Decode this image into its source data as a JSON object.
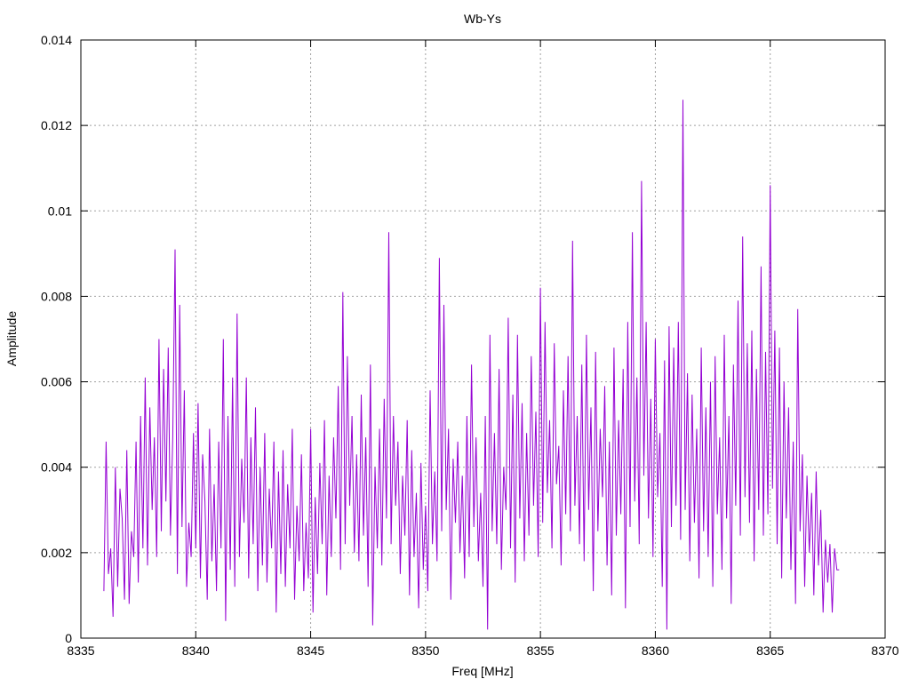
{
  "chart_data": {
    "type": "line",
    "title": "Wb-Ys",
    "xlabel": "Freq [MHz]",
    "ylabel": "Amplitude",
    "xlim": [
      8335,
      8370
    ],
    "ylim": [
      0,
      0.014
    ],
    "xticks": [
      "8335",
      "8340",
      "8345",
      "8350",
      "8355",
      "8360",
      "8365",
      "8370"
    ],
    "yticks": [
      "0",
      "0.002",
      "0.004",
      "0.006",
      "0.008",
      "0.01",
      "0.012",
      "0.014"
    ],
    "grid": true,
    "series": [
      {
        "name": "Wb-Ys",
        "color": "#9400d3",
        "x_start": 8336.0,
        "x_step": 0.1,
        "values": [
          0.0011,
          0.0046,
          0.0015,
          0.0021,
          0.0005,
          0.004,
          0.0012,
          0.0035,
          0.0028,
          0.0009,
          0.0044,
          0.0008,
          0.0025,
          0.0019,
          0.0046,
          0.0013,
          0.0052,
          0.0021,
          0.0061,
          0.0017,
          0.0054,
          0.003,
          0.0047,
          0.0019,
          0.007,
          0.0025,
          0.0063,
          0.0032,
          0.0068,
          0.0024,
          0.0047,
          0.0091,
          0.0015,
          0.0078,
          0.0026,
          0.0058,
          0.0012,
          0.0027,
          0.0019,
          0.0048,
          0.0021,
          0.0055,
          0.0014,
          0.0043,
          0.0032,
          0.0009,
          0.0049,
          0.0018,
          0.0036,
          0.0011,
          0.0046,
          0.0021,
          0.007,
          0.0004,
          0.0052,
          0.0016,
          0.0061,
          0.0012,
          0.0076,
          0.0019,
          0.0042,
          0.0027,
          0.0061,
          0.0014,
          0.0047,
          0.0022,
          0.0054,
          0.0011,
          0.004,
          0.0017,
          0.0048,
          0.0013,
          0.0035,
          0.0021,
          0.0046,
          0.0006,
          0.0039,
          0.0015,
          0.0044,
          0.0012,
          0.0036,
          0.0021,
          0.0049,
          0.0009,
          0.0031,
          0.0018,
          0.0043,
          0.0011,
          0.0027,
          0.0014,
          0.0049,
          0.0006,
          0.0033,
          0.0015,
          0.0041,
          0.0022,
          0.0051,
          0.001,
          0.0038,
          0.0019,
          0.0047,
          0.0028,
          0.0059,
          0.0016,
          0.0081,
          0.0022,
          0.0066,
          0.0031,
          0.0052,
          0.002,
          0.0043,
          0.0018,
          0.0057,
          0.0024,
          0.0047,
          0.0012,
          0.0064,
          0.0003,
          0.004,
          0.0021,
          0.0049,
          0.0017,
          0.0056,
          0.0028,
          0.0095,
          0.0022,
          0.0052,
          0.0031,
          0.0046,
          0.0015,
          0.0038,
          0.0024,
          0.0051,
          0.001,
          0.0044,
          0.0019,
          0.0034,
          0.0007,
          0.0041,
          0.0016,
          0.0031,
          0.0011,
          0.0058,
          0.0022,
          0.0039,
          0.0018,
          0.0089,
          0.0025,
          0.0078,
          0.003,
          0.0049,
          0.0009,
          0.0042,
          0.0027,
          0.0046,
          0.002,
          0.0038,
          0.0014,
          0.0052,
          0.0019,
          0.0064,
          0.0026,
          0.0047,
          0.0018,
          0.0034,
          0.0012,
          0.0052,
          0.0002,
          0.0071,
          0.0025,
          0.0048,
          0.0022,
          0.0063,
          0.0016,
          0.004,
          0.003,
          0.0075,
          0.0021,
          0.0057,
          0.0013,
          0.0071,
          0.0028,
          0.0055,
          0.0018,
          0.0048,
          0.0024,
          0.0066,
          0.0031,
          0.0053,
          0.0019,
          0.0082,
          0.0027,
          0.0074,
          0.0034,
          0.0051,
          0.0021,
          0.0069,
          0.0036,
          0.0045,
          0.0017,
          0.0058,
          0.0029,
          0.0066,
          0.0025,
          0.0093,
          0.0031,
          0.0052,
          0.0022,
          0.0064,
          0.0018,
          0.0071,
          0.003,
          0.0054,
          0.0011,
          0.0067,
          0.0025,
          0.0049,
          0.0033,
          0.0059,
          0.0017,
          0.0046,
          0.001,
          0.0068,
          0.0024,
          0.0051,
          0.0029,
          0.0063,
          0.0007,
          0.0074,
          0.0026,
          0.0095,
          0.0032,
          0.0061,
          0.0022,
          0.0107,
          0.0038,
          0.0074,
          0.0028,
          0.0056,
          0.0019,
          0.007,
          0.0033,
          0.0048,
          0.0012,
          0.0065,
          0.0002,
          0.0073,
          0.0026,
          0.0068,
          0.0031,
          0.0074,
          0.0023,
          0.0126,
          0.003,
          0.0062,
          0.0018,
          0.0057,
          0.0027,
          0.0049,
          0.0014,
          0.0068,
          0.0025,
          0.0054,
          0.0019,
          0.006,
          0.0012,
          0.0066,
          0.0029,
          0.0047,
          0.0016,
          0.0071,
          0.0028,
          0.0052,
          0.0008,
          0.0064,
          0.0031,
          0.0079,
          0.0024,
          0.0094,
          0.0033,
          0.0069,
          0.0027,
          0.0072,
          0.0018,
          0.0063,
          0.003,
          0.0087,
          0.0024,
          0.0067,
          0.0029,
          0.0106,
          0.0035,
          0.0072,
          0.0022,
          0.0068,
          0.0014,
          0.006,
          0.0028,
          0.0054,
          0.0016,
          0.0046,
          0.0008,
          0.0077,
          0.0025,
          0.0043,
          0.0012,
          0.0038,
          0.002,
          0.0034,
          0.001,
          0.0039,
          0.0017,
          0.003,
          0.0006,
          0.0023,
          0.0013,
          0.0022,
          0.0006,
          0.0021,
          0.0016,
          0.0016
        ]
      }
    ]
  }
}
